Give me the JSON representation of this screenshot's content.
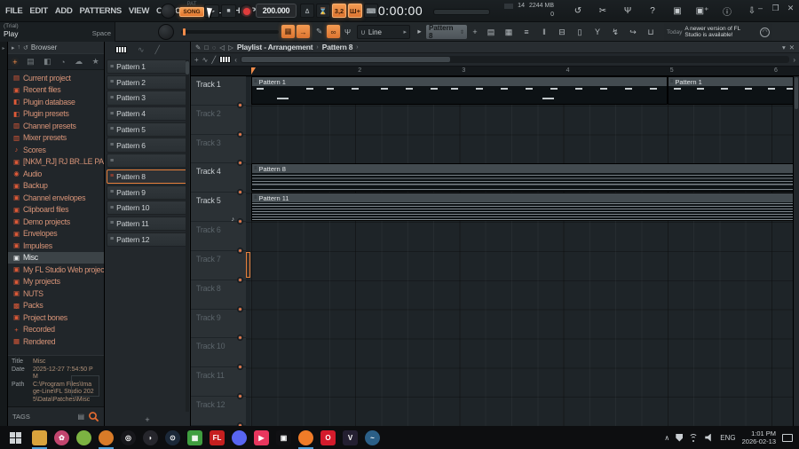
{
  "colors": {
    "accent": "#f28c4a",
    "selection_border": "#e8813c",
    "record_red": "#e03c3c",
    "taskbar_underline": "#4f9fd8"
  },
  "titlebar": {
    "menus": [
      {
        "label": "FILE"
      },
      {
        "label": "EDIT"
      },
      {
        "label": "ADD"
      },
      {
        "label": "PATTERNS"
      },
      {
        "label": "VIEW"
      },
      {
        "label": "OPTIONS"
      },
      {
        "label": "TOOLS"
      },
      {
        "label": "HELP"
      }
    ],
    "mode_pat": "PAT",
    "mode_song": "SONG",
    "play_glyph": "▶",
    "stop_glyph": "■",
    "tempo": "200.000",
    "transport_icons": [
      {
        "name": "metronome-icon",
        "glyph": "∆"
      },
      {
        "name": "wait-input-icon",
        "glyph": "⌛"
      },
      {
        "name": "precount-icon",
        "glyph": "3,2",
        "orange": true
      },
      {
        "name": "blend-notes-icon",
        "glyph": "Ш+",
        "orange": true
      },
      {
        "name": "step-edit-icon",
        "glyph": "⌨"
      }
    ],
    "time": "0:00:00",
    "perf": {
      "cpu": "14",
      "mem": "2244 MB",
      "poly": "0"
    },
    "right_icons": [
      {
        "name": "one-click-record-icon",
        "glyph": "↺"
      },
      {
        "name": "cut-icon",
        "glyph": "✂"
      },
      {
        "name": "mic-icon",
        "glyph": "Ψ"
      },
      {
        "name": "help-icon",
        "glyph": "?"
      },
      {
        "name": "save-icon",
        "glyph": "▣"
      },
      {
        "name": "save-new-version-icon",
        "glyph": "▣⁺"
      },
      {
        "name": "info-icon",
        "glyph": "ⓘ"
      },
      {
        "name": "download-icon",
        "glyph": "⇩"
      }
    ],
    "window": {
      "minimize": "–",
      "maximize": "❐",
      "close": "✕"
    }
  },
  "toolbar2": {
    "hint": {
      "trial": "(Trial)",
      "action": "Play",
      "shortcut": "Space"
    },
    "snap": {
      "magnet": "∪",
      "value": "Line",
      "arrow": "▸"
    },
    "follow_glyph": "▦",
    "autoscroll_glyph": "→",
    "slide_glyph": "✎",
    "link_glyph": "∞",
    "micstand_glyph": "Ψ",
    "arrow_btn": "▸",
    "pattern_selector": {
      "value": "Pattern 8",
      "updown": "⇕",
      "plus": "+"
    },
    "strip_icons": [
      {
        "name": "playlist-icon",
        "glyph": "▤"
      },
      {
        "name": "piano-roll-icon",
        "glyph": "▦"
      },
      {
        "name": "channel-rack-icon",
        "glyph": "≡"
      },
      {
        "name": "mixer-icon",
        "glyph": "‖"
      },
      {
        "name": "browser-toggle-icon",
        "glyph": "⊟"
      },
      {
        "name": "plugin-picker-icon",
        "glyph": "▯"
      },
      {
        "name": "tempo-tap-icon",
        "glyph": "Y"
      },
      {
        "name": "touch-controller-icon",
        "glyph": "↯"
      },
      {
        "name": "gesture-icon",
        "glyph": "↪"
      },
      {
        "name": "shop-icon",
        "glyph": "⊔"
      }
    ],
    "notification": {
      "when": "Today",
      "text": "A newer version of FL Studio is available!",
      "globe": "◠"
    }
  },
  "browser": {
    "rail_glyph": "▸",
    "header": {
      "title": "Browser",
      "icons": [
        "▸",
        "↑",
        "↺"
      ]
    },
    "tabs": [
      {
        "name": "browser-tab-all",
        "glyph": "+",
        "active": true
      },
      {
        "name": "browser-tab-files",
        "glyph": "▤"
      },
      {
        "name": "browser-tab-plugins",
        "glyph": "◧"
      },
      {
        "name": "browser-tab-recent",
        "glyph": "◔"
      },
      {
        "name": "browser-tab-cloud",
        "glyph": "☁"
      },
      {
        "name": "browser-tab-favorites",
        "glyph": "★"
      }
    ],
    "items": [
      {
        "label": "Current project",
        "glyph": "▤"
      },
      {
        "label": "Recent files",
        "glyph": "▣"
      },
      {
        "label": "Plugin database",
        "glyph": "◧"
      },
      {
        "label": "Plugin presets",
        "glyph": "◧"
      },
      {
        "label": "Channel presets",
        "glyph": "▥"
      },
      {
        "label": "Mixer presets",
        "glyph": "▥"
      },
      {
        "label": "Scores",
        "glyph": "♪"
      },
      {
        "label": "[NKM_RJ] RJ BR..LE PACK FREE",
        "glyph": "▣"
      },
      {
        "label": "Audio",
        "glyph": "◉"
      },
      {
        "label": "Backup",
        "glyph": "▣"
      },
      {
        "label": "Channel envelopes",
        "glyph": "▣"
      },
      {
        "label": "Clipboard files",
        "glyph": "▣"
      },
      {
        "label": "Demo projects",
        "glyph": "▣"
      },
      {
        "label": "Envelopes",
        "glyph": "▣"
      },
      {
        "label": "Impulses",
        "glyph": "▣"
      },
      {
        "label": "Misc",
        "glyph": "▣",
        "selected": true
      },
      {
        "label": "My FL Studio Web projects",
        "glyph": "▣"
      },
      {
        "label": "My projects",
        "glyph": "▣"
      },
      {
        "label": "NUTS",
        "glyph": "▣"
      },
      {
        "label": "Packs",
        "glyph": "▩"
      },
      {
        "label": "Project bones",
        "glyph": "▣"
      },
      {
        "label": "Recorded",
        "glyph": "+"
      },
      {
        "label": "Rendered",
        "glyph": "▦"
      }
    ],
    "details": {
      "title_label": "Title",
      "title": "Misc",
      "date_label": "Date",
      "date": "2025-12-27 7:54:50 PM",
      "path_label": "Path",
      "path": "C:\\Program Files\\Image-Line\\FL Studio 2025\\Data\\Patches\\Misc"
    },
    "tags_label": "TAGS"
  },
  "picker": {
    "wave_glyph": "∿",
    "curve_glyph": "╱",
    "plus": "+",
    "patterns": [
      {
        "label": "Pattern 1"
      },
      {
        "label": "Pattern 2"
      },
      {
        "label": "Pattern 3"
      },
      {
        "label": "Pattern 4"
      },
      {
        "label": "Pattern 5"
      },
      {
        "label": "Pattern 6"
      },
      {
        "label": ""
      },
      {
        "label": "Pattern 8",
        "selected": true
      },
      {
        "label": "Pattern 9"
      },
      {
        "label": "Pattern 10"
      },
      {
        "label": "Pattern 11"
      },
      {
        "label": "Pattern 12"
      }
    ]
  },
  "playlist": {
    "title_icons": [
      "✎",
      "□",
      "◌",
      "◁"
    ],
    "play_mini": "▷",
    "breadcrumb": {
      "root": "Playlist - Arrangement",
      "sep": "›",
      "current": "Pattern 8",
      "sep2": "›"
    },
    "win_icons": {
      "collapse": "▾",
      "close": "✕"
    },
    "toolbar": {
      "plus": "+",
      "wave": "∿",
      "curve": "╱",
      "left": "‹",
      "right": "›"
    },
    "ruler_bars": [
      "2",
      "3",
      "4",
      "5",
      "6"
    ],
    "tracks": [
      {
        "name": "Track 1",
        "bright": true
      },
      {
        "name": "Track 2"
      },
      {
        "name": "Track 3"
      },
      {
        "name": "Track 4",
        "bright": true
      },
      {
        "name": "Track 5",
        "bright": true,
        "note": "♪"
      },
      {
        "name": "Track 6"
      },
      {
        "name": "Track 7"
      },
      {
        "name": "Track 8"
      },
      {
        "name": "Track 9"
      },
      {
        "name": "Track 10"
      },
      {
        "name": "Track 11"
      },
      {
        "name": "Track 12"
      }
    ],
    "clips": [
      {
        "track": 1,
        "label": "Pattern 1",
        "start": 1,
        "end": 5,
        "kind": "notes",
        "ticks": [
          1,
          13,
          18,
          24,
          31,
          37,
          43,
          48,
          54,
          60,
          66,
          72,
          78,
          84,
          90,
          96
        ],
        "low_ticks": [
          6,
          70
        ]
      },
      {
        "track": 1,
        "label": "Pattern 1",
        "start": 5,
        "end": 6.28,
        "kind": "notes",
        "ticks": [
          4,
          22,
          40,
          58,
          76,
          90
        ],
        "low_ticks": []
      },
      {
        "track": 4,
        "label": "Pattern 8",
        "start": 1,
        "end": 6.28,
        "kind": "stripes4",
        "ticks": [],
        "low_ticks": []
      },
      {
        "track": 5,
        "label": "Pattern 11",
        "start": 1,
        "end": 6.28,
        "kind": "stripes7",
        "ticks": [],
        "low_ticks": []
      }
    ],
    "selection": {
      "track": 7
    }
  },
  "taskbar": {
    "apps": [
      {
        "name": "taskbar-file-explorer",
        "color": "#d9a33c",
        "glyph": "",
        "open": true
      },
      {
        "name": "taskbar-paint-app",
        "color": "#c2456e",
        "glyph": "✿",
        "circle": true
      },
      {
        "name": "taskbar-green-app",
        "color": "#7cb342",
        "glyph": "",
        "circle": true
      },
      {
        "name": "taskbar-orange-app",
        "color": "#d97b28",
        "glyph": "",
        "circle": true,
        "open": true
      },
      {
        "name": "taskbar-obs",
        "color": "#17171b",
        "glyph": "◎",
        "circle": true
      },
      {
        "name": "taskbar-cam-app",
        "color": "#26262c",
        "glyph": "◗",
        "circle": true
      },
      {
        "name": "taskbar-steam",
        "color": "#1b2838",
        "glyph": "⊙",
        "circle": true
      },
      {
        "name": "taskbar-minecraft",
        "color": "#3f9e3f",
        "glyph": "▦"
      },
      {
        "name": "taskbar-fl-asio",
        "color": "#c51f1f",
        "glyph": "FL"
      },
      {
        "name": "taskbar-discord",
        "color": "#5865f2",
        "glyph": "",
        "circle": true
      },
      {
        "name": "taskbar-video-app",
        "color": "#e8365e",
        "glyph": "▶"
      },
      {
        "name": "taskbar-capcut",
        "color": "#101013",
        "glyph": "▣"
      },
      {
        "name": "taskbar-fl-studio",
        "color": "#f07c28",
        "glyph": "",
        "circle": true,
        "active": true,
        "open": true
      },
      {
        "name": "taskbar-opera-gx",
        "color": "#d41b2c",
        "glyph": "O"
      },
      {
        "name": "taskbar-v-app",
        "color": "#241f31",
        "glyph": "V"
      },
      {
        "name": "taskbar-browser-app",
        "color": "#2b5f87",
        "glyph": "~",
        "circle": true
      }
    ],
    "tray": {
      "chevron": "∧",
      "lang": "ENG",
      "time": "1:01 PM",
      "date": "2026-02-13"
    }
  }
}
